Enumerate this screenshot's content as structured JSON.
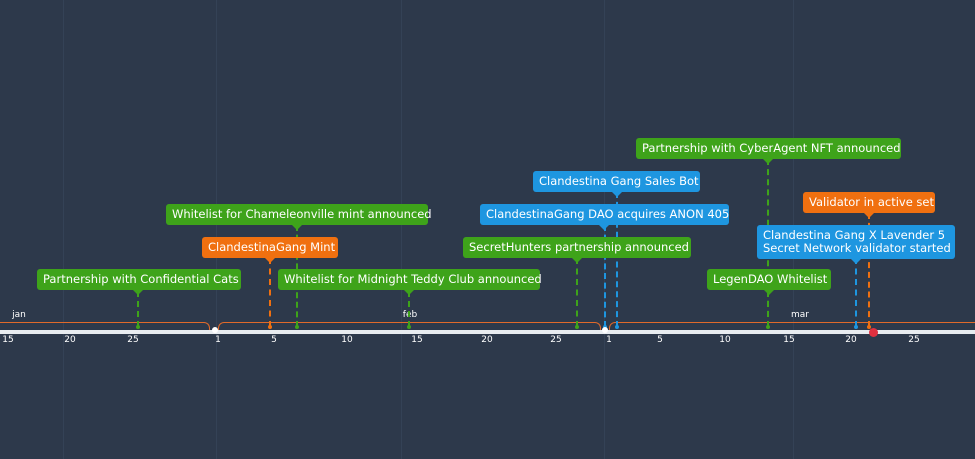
{
  "months": [
    "jan",
    "feb",
    "mar"
  ],
  "ticks": [
    "15",
    "20",
    "25",
    "1",
    "5",
    "10",
    "15",
    "20",
    "25",
    "1",
    "5",
    "10",
    "15",
    "20",
    "25"
  ],
  "colors": {
    "green": "#3ea31a",
    "orange": "#f07010",
    "blue": "#1e96e0",
    "background": "#2d394b",
    "axis": "#e8ecf0",
    "today": "#e0303f"
  },
  "events": [
    {
      "text": "Partnership with Confidential Cats",
      "color": "green"
    },
    {
      "text": "ClandestinaGang Mint",
      "color": "orange"
    },
    {
      "text": "Whitelist for Chameleonville mint announced",
      "color": "green"
    },
    {
      "text": "Whitelist for Midnight Teddy Club announced",
      "color": "green"
    },
    {
      "text": "SecretHunters partnership announced",
      "color": "green"
    },
    {
      "text": "ClandestinaGang DAO acquires ANON 405",
      "color": "blue"
    },
    {
      "text": "Clandestina Gang Sales Bot",
      "color": "blue"
    },
    {
      "text": "Partnership with CyberAgent NFT announced",
      "color": "green"
    },
    {
      "text": "LegenDAO Whitelist",
      "color": "green"
    },
    {
      "text": "Clandestina Gang X Lavender 5",
      "text2": "Secret Network validator started",
      "color": "blue"
    },
    {
      "text": "Validator in active set",
      "color": "orange"
    }
  ]
}
